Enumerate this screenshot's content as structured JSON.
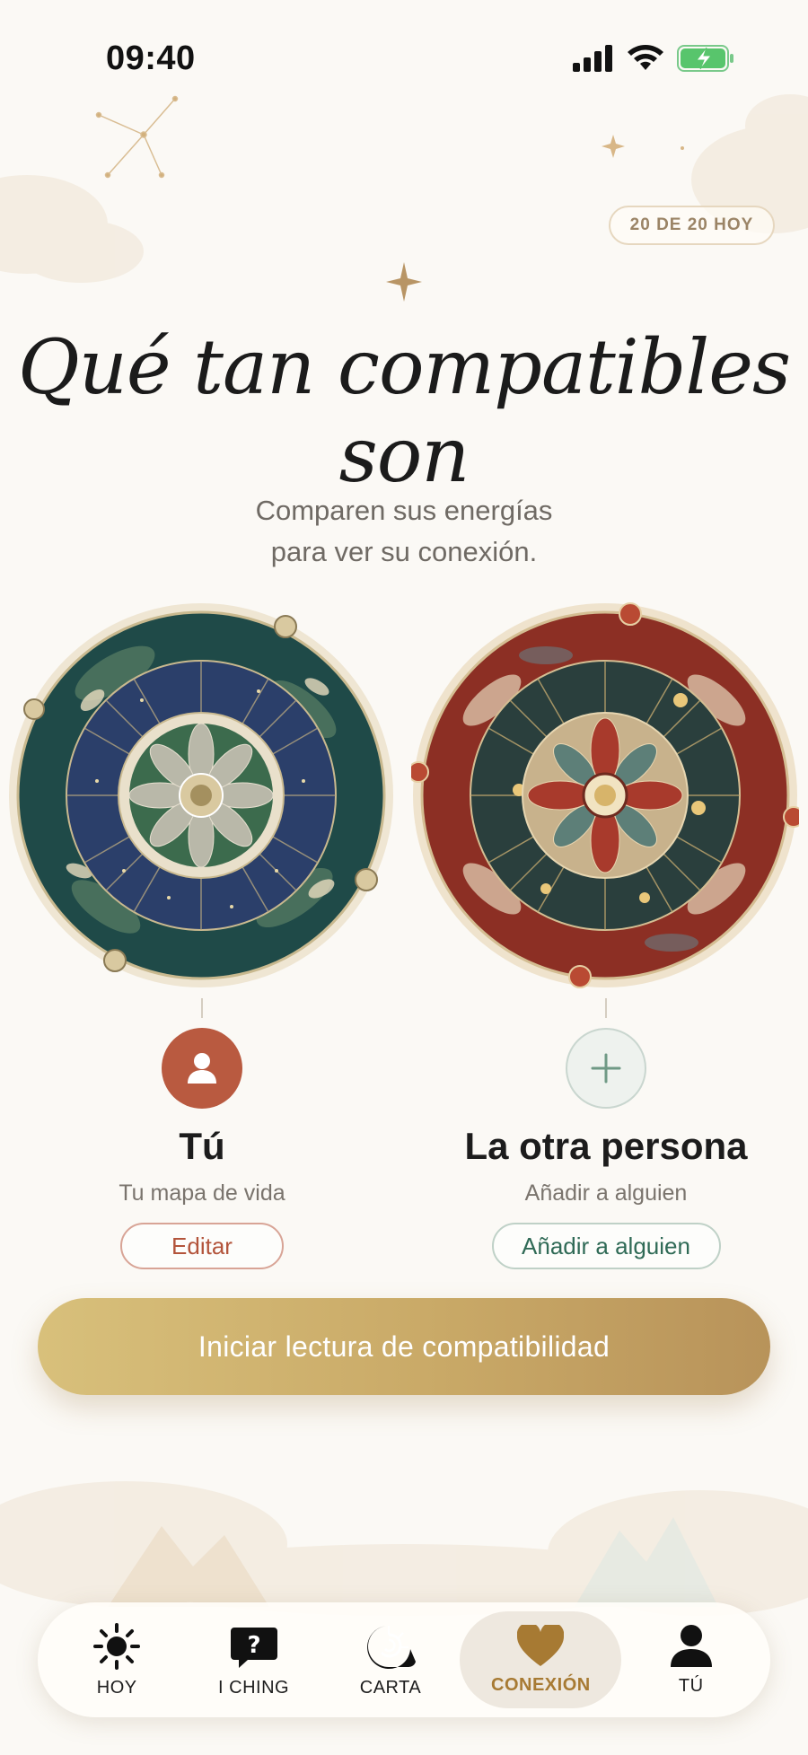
{
  "status_bar": {
    "time": "09:40"
  },
  "counter": {
    "label": "20 DE 20 HOY"
  },
  "title": "Qué tan compatibles son",
  "subtitle": {
    "line1": "Comparen sus energías",
    "line2": "para ver su conexión."
  },
  "people": {
    "you": {
      "name": "Tú",
      "subtitle": "Tu mapa de vida",
      "button": "Editar"
    },
    "other": {
      "name": "La otra persona",
      "subtitle": "Añadir a alguien",
      "button": "Añadir a alguien"
    }
  },
  "cta": {
    "label": "Iniciar lectura de compatibilidad"
  },
  "tabs": [
    {
      "label": "HOY",
      "icon": "sun-icon"
    },
    {
      "label": "I CHING",
      "icon": "question-bubble-icon"
    },
    {
      "label": "CARTA",
      "icon": "nautilus-shell-icon"
    },
    {
      "label": "CONEXIÓN",
      "icon": "heart-icon",
      "active": true
    },
    {
      "label": "TÚ",
      "icon": "person-icon"
    }
  ],
  "colors": {
    "accent_gold": "#c9a967",
    "you_terracotta": "#b95a40",
    "other_green": "#2f6a56",
    "active_tab": "#a77a33"
  }
}
